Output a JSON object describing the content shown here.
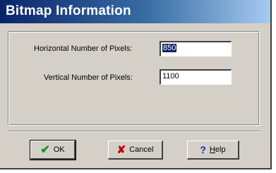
{
  "window": {
    "title": "Bitmap Information"
  },
  "fields": {
    "horizontal": {
      "label": "Horizontal Number of Pixels:",
      "value": "850"
    },
    "vertical": {
      "label": "Vertical Number of Pixels:",
      "value": "1100"
    }
  },
  "buttons": {
    "ok": {
      "label": "OK",
      "icon": "checkmark-icon"
    },
    "cancel": {
      "label": "Cancel",
      "icon": "x-icon"
    },
    "help": {
      "label_first": "H",
      "label_rest": "elp",
      "icon": "question-mark-icon"
    }
  },
  "colors": {
    "title_bar_start": "#0a246a",
    "title_bar_end": "#a6caf0",
    "dialog_bg": "#d4d0c8",
    "selection_bg": "#0a246a"
  }
}
